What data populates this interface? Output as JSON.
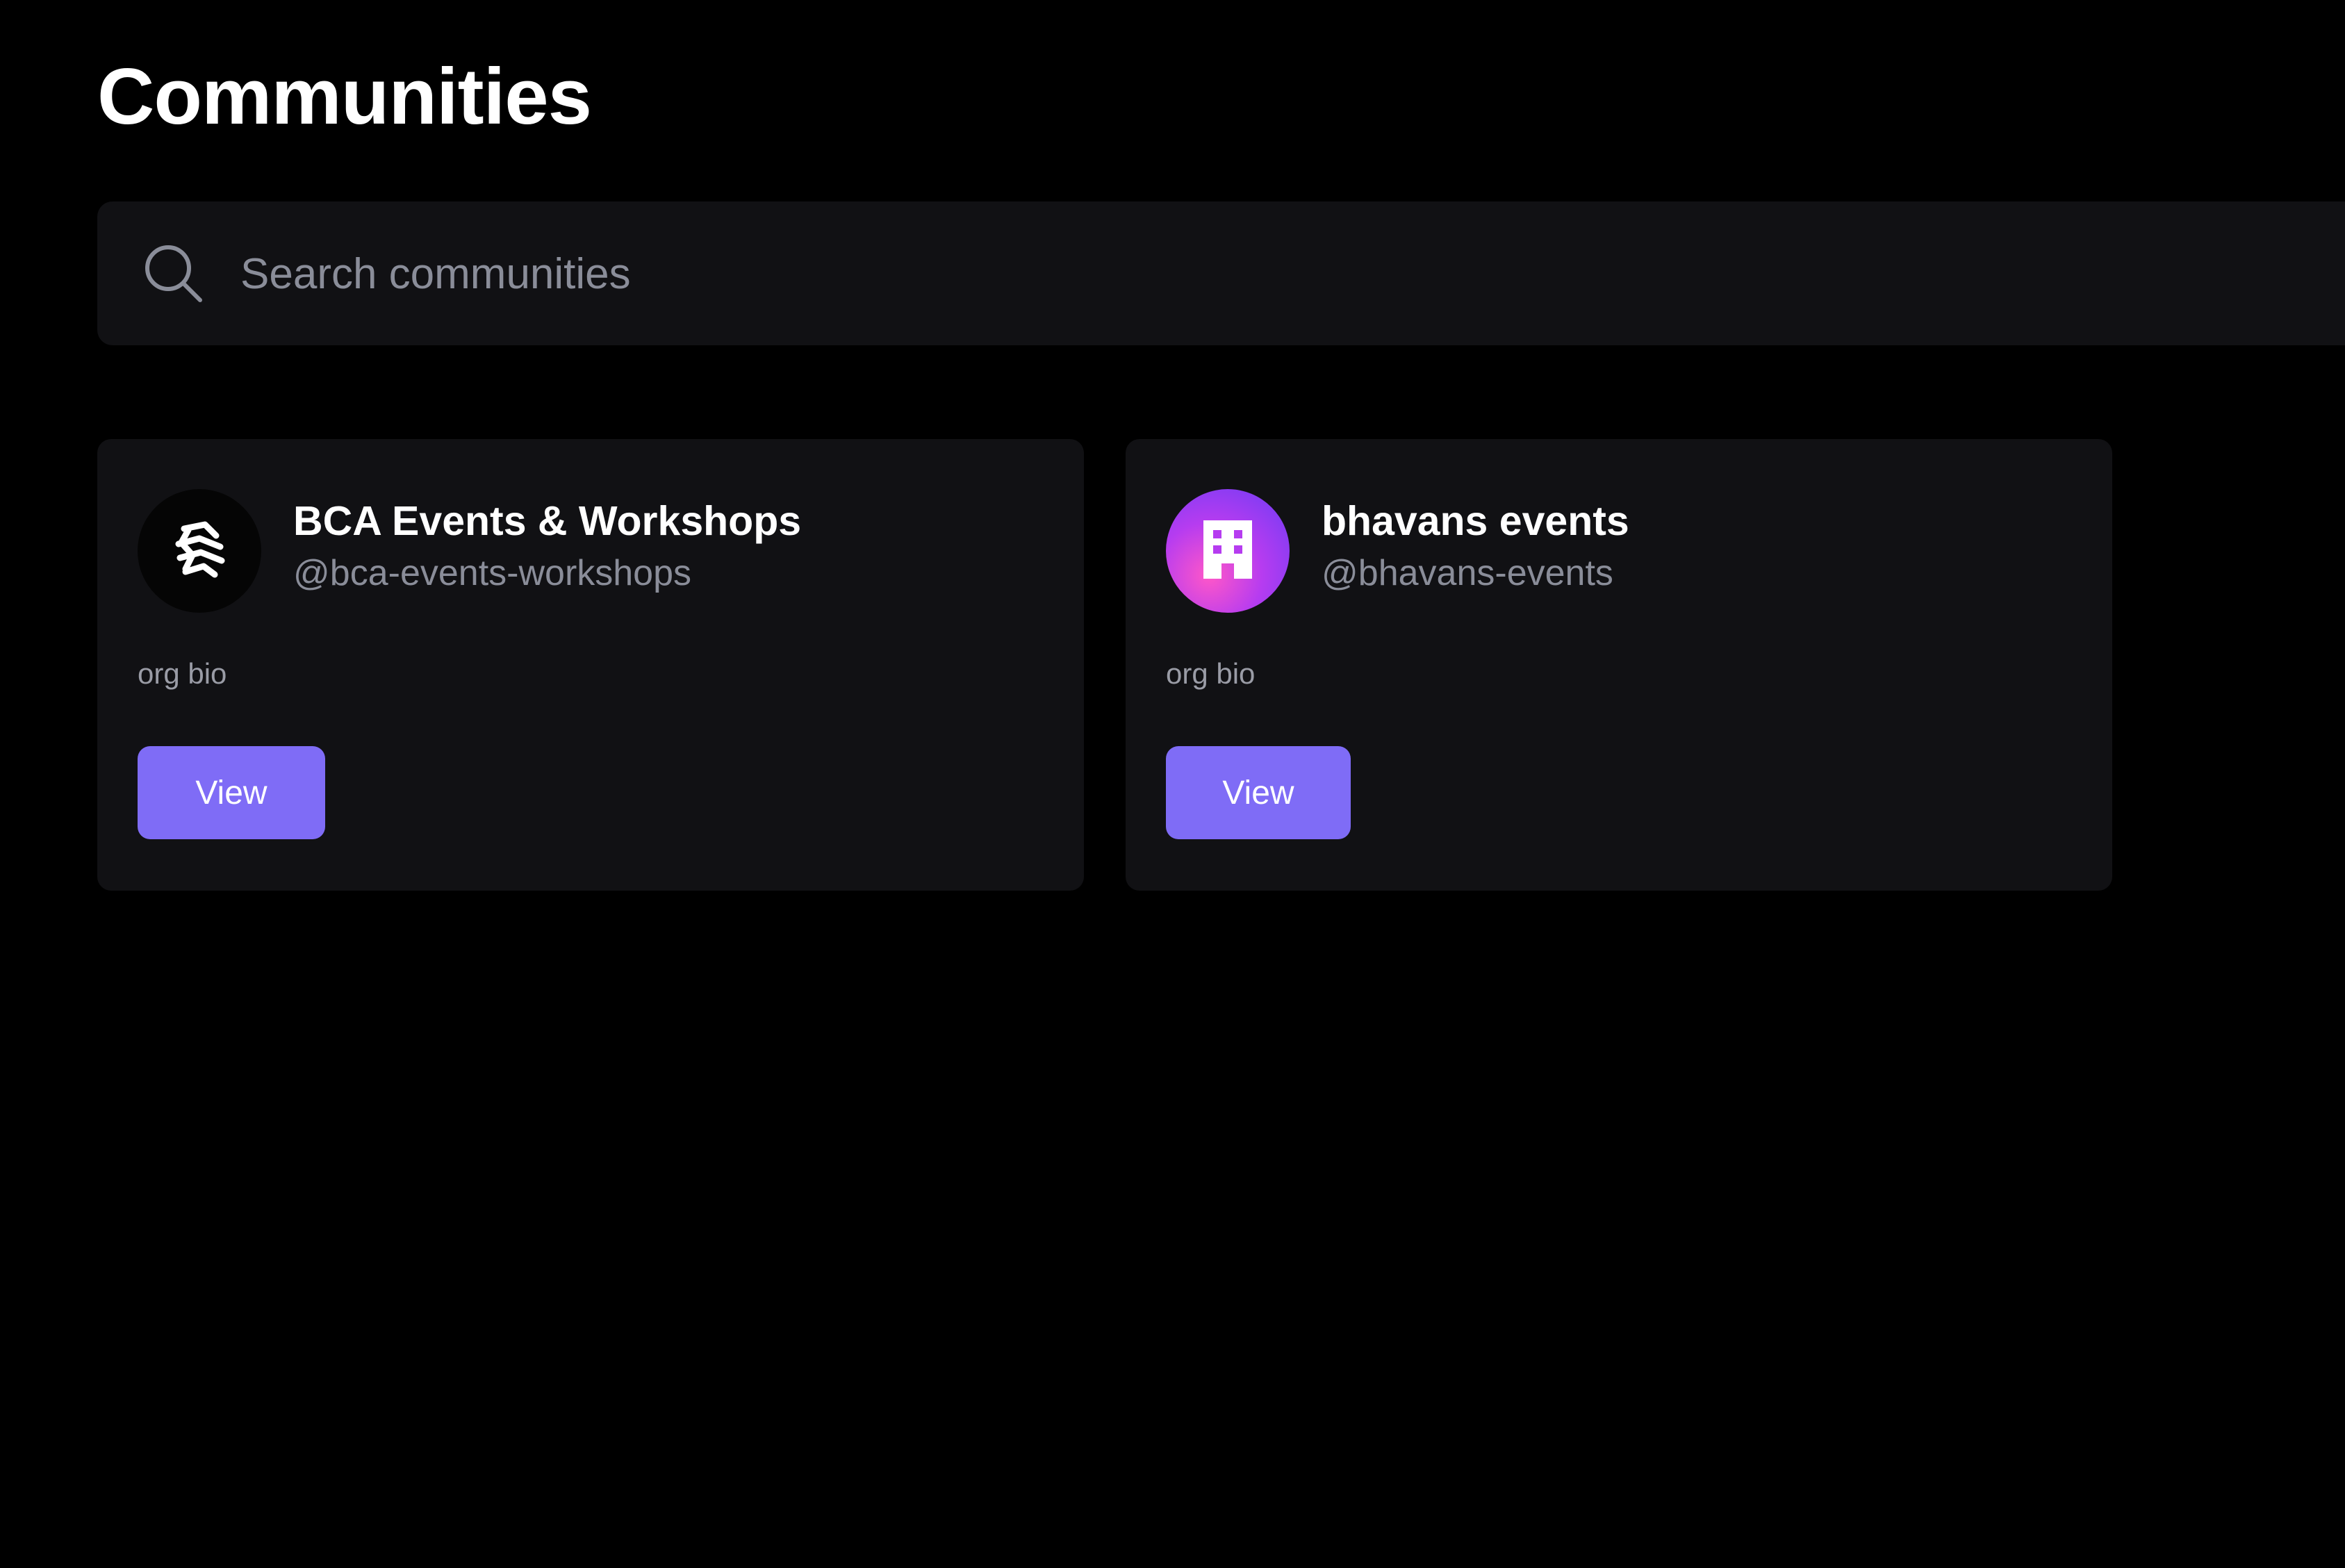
{
  "page": {
    "title": "Communities"
  },
  "search": {
    "placeholder": "Search communities",
    "value": "",
    "icon": "search-icon"
  },
  "communities": [
    {
      "name": "BCA Events & Workshops",
      "handle": "@bca-events-workshops",
      "bio": "org bio",
      "avatar_icon": "bca-logo-icon",
      "button_label": "View"
    },
    {
      "name": "bhavans events",
      "handle": "@bhavans-events",
      "bio": "org bio",
      "avatar_icon": "building-icon",
      "button_label": "View"
    }
  ],
  "colors": {
    "background": "#000000",
    "surface": "#111114",
    "accent": "#7f6cf6",
    "muted_text": "#8a8d99"
  }
}
